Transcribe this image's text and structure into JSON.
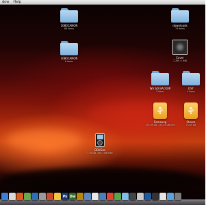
{
  "menubar": {
    "items": [
      "dow",
      "Help"
    ]
  },
  "desktop": {
    "icons": [
      {
        "name": "1080CANON",
        "info": "66 items",
        "type": "folder"
      },
      {
        "name": "1080CANON",
        "info": "6 items",
        "type": "folder"
      },
      {
        "name": "downloads",
        "info": "74 items",
        "type": "folder"
      },
      {
        "name": "Cover",
        "info": "1,280 × 848",
        "type": "image"
      },
      {
        "name": "WE SD BACKUP",
        "info": "3 items",
        "type": "folder"
      },
      {
        "name": "OST",
        "info": "4 items",
        "type": "folder"
      },
      {
        "name": "Samsung",
        "info": "275.09 GB, 275.03 GB free",
        "type": "drive"
      },
      {
        "name": "Steam",
        "info": "73.89 GB",
        "type": "drive"
      },
      {
        "name": "OBeGas",
        "info": "7.59 GB, 350.7 MB free",
        "type": "ipod"
      }
    ]
  },
  "dock": {
    "items": [
      {
        "label": "",
        "color": "#3b7fd6"
      },
      {
        "label": "",
        "color": "#d9d9d9"
      },
      {
        "label": "",
        "color": "#e05a1e"
      },
      {
        "label": "",
        "color": "#6aa84f"
      },
      {
        "label": "",
        "color": "#2f6fb5"
      },
      {
        "label": "",
        "color": "#9a9a9a"
      },
      {
        "label": "",
        "color": "#c94b2a"
      },
      {
        "label": "",
        "color": "#f4c542"
      },
      {
        "label": "Ps",
        "color": "#1a3b6e"
      },
      {
        "label": "Dw",
        "color": "#2f6b2a"
      },
      {
        "label": "",
        "color": "#b8860b"
      },
      {
        "label": "",
        "color": "#5a86c4"
      },
      {
        "label": "",
        "color": "#e8e8e8"
      },
      {
        "label": "",
        "color": "#4d7ebc"
      },
      {
        "label": "",
        "color": "#e34234"
      },
      {
        "label": "",
        "color": "#57a64a"
      },
      {
        "label": "",
        "color": "#7fbfe9"
      },
      {
        "label": "",
        "color": "#444444"
      },
      {
        "label": "",
        "color": "#c8c8c8"
      },
      {
        "label": "",
        "color": "#1e5a9e"
      },
      {
        "label": "",
        "color": "#333333"
      },
      {
        "label": "",
        "color": "#e6e6e6"
      },
      {
        "label": "",
        "color": "#5aa2dd"
      },
      {
        "label": "",
        "color": "#7b7b7b"
      }
    ]
  }
}
